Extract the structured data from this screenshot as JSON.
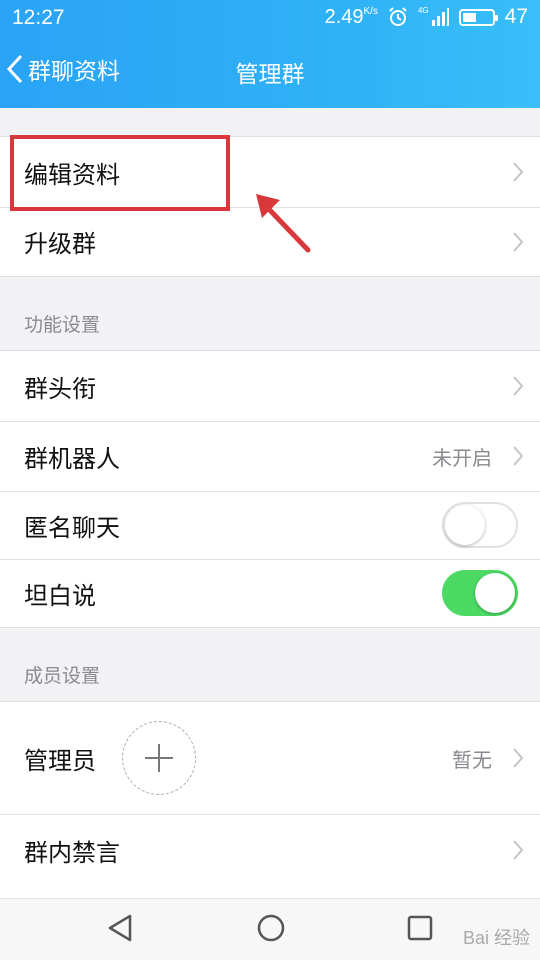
{
  "status": {
    "time": "12:27",
    "speed": "2.49",
    "speed_unit": "K/s",
    "network": "4G",
    "battery": "47",
    "battery_level": 0.47
  },
  "nav": {
    "back_label": "群聊资料",
    "title": "管理群"
  },
  "group1": [
    {
      "label": "编辑资料"
    },
    {
      "label": "升级群"
    }
  ],
  "section_function": "功能设置",
  "group2": [
    {
      "label": "群头衔"
    },
    {
      "label": "群机器人",
      "value": "未开启"
    },
    {
      "label": "匿名聊天",
      "toggle": false
    },
    {
      "label": "坦白说",
      "toggle": true
    }
  ],
  "section_member": "成员设置",
  "group3": [
    {
      "label": "管理员",
      "value": "暂无"
    },
    {
      "label": "群内禁言"
    }
  ],
  "colors": {
    "accent": "#2aa3f5",
    "toggle_on": "#4cd964",
    "annotation": "#d9383b"
  },
  "watermark": "Bai 经验"
}
